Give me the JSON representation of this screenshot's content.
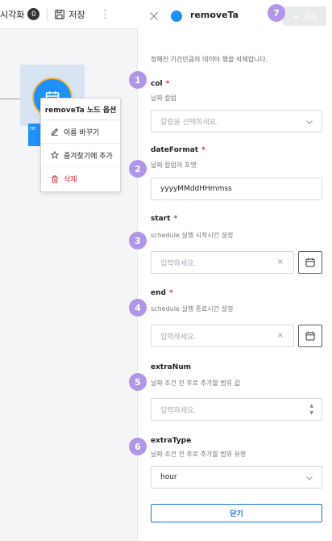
{
  "toolbar": {
    "visualize_label": "시각화",
    "visualize_count": "0",
    "save_label": "저장"
  },
  "canvas": {
    "node_label_partial": "re"
  },
  "context_menu": {
    "title": "removeTa 노드 옵션",
    "items": [
      {
        "label": "이름 바꾸기"
      },
      {
        "label": "즐겨찾기에 추가"
      },
      {
        "label": "삭제"
      }
    ]
  },
  "panel": {
    "title": "removeTa",
    "add_label": "추가",
    "description": "정해진 기간만큼의 데이터 행을 삭제합니다.",
    "fields": {
      "col": {
        "label": "col",
        "help": "날짜 칼럼",
        "placeholder": "칼럼을 선택하세요."
      },
      "dateFormat": {
        "label": "dateFormat",
        "help": "날짜 칼럼의 포맷",
        "value": "yyyyMMddHHmmss"
      },
      "start": {
        "label": "start",
        "help": "schedule 실행 시작시간 설정",
        "placeholder": "입력하세요."
      },
      "end": {
        "label": "end",
        "help": "schedule 실행 종료시간 설정",
        "placeholder": "입력하세요."
      },
      "extraNum": {
        "label": "extraNum",
        "help": "날짜 조건 전 후로 추가할 범위 값",
        "placeholder": "입력하세요."
      },
      "extraType": {
        "label": "extraType",
        "help": "날짜 조건 전 후로 추가할 범위 유형",
        "value": "hour"
      }
    },
    "required_mark": "*",
    "clear_mark": "×",
    "close_label": "닫기"
  },
  "badges": [
    "1",
    "2",
    "3",
    "4",
    "5",
    "6",
    "7"
  ],
  "colors": {
    "accent": "#1e90ff",
    "badge": "#b196e8",
    "required": "#e0293b",
    "close_button": "#1e78d7"
  }
}
